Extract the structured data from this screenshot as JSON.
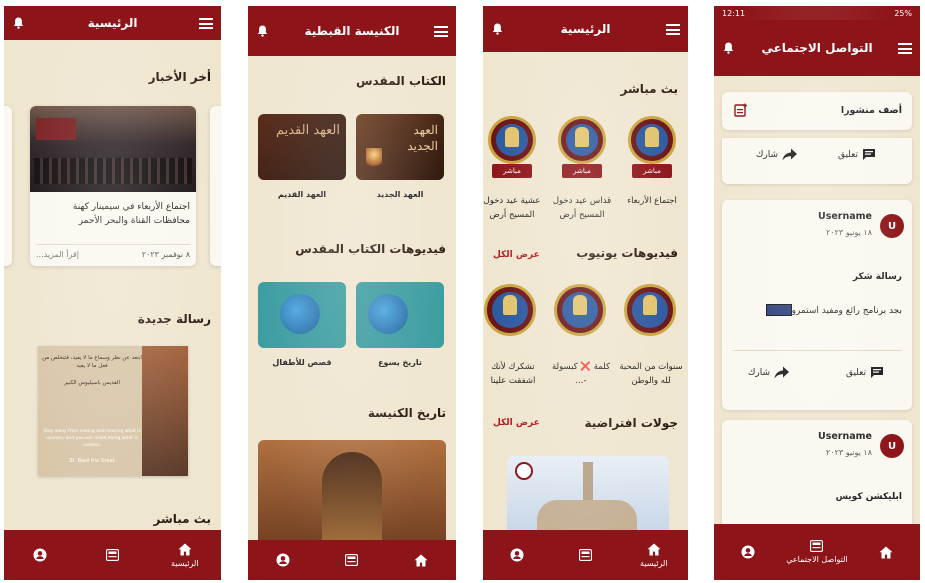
{
  "screen1": {
    "header_title": "الرئيسية",
    "latest_news": "أخر الأخبار",
    "news_text": "اجتماع الأربعاء في سيمينار كهنة محافظات القناة والبحر الأحمر",
    "news_date": "٨ نوفمبر ٢٠٢٣",
    "read_more": "إقرأ المزيد...",
    "new_message": "رسالة جديدة",
    "message_ar": "ابتعد عن نظر وسماع ما لا يفيد، فتتخلص من فعل ما لا يفيد",
    "message_ar_sign": "القديس باسيليوس الكبير",
    "message_en": "Stay away from seeing and hearing what is useless, and you will avoid doing what is useless.",
    "message_en_sign": "St. Basil the Great",
    "live_partial": "بث مباشر",
    "nav_home": "الرئيسية"
  },
  "screen2": {
    "header_title": "الكنيسة القبطية",
    "bible": "الكتاب المقدس",
    "old_testament_img": "العهد القديم",
    "new_testament_img": "العهد الجديد",
    "old_testament": "العهد القديم",
    "new_testament": "العهد الجديد",
    "bible_videos": "فيديوهات الكتاب المقدس",
    "kids_stories": "قصص للأطفال",
    "jesus_history": "تاريخ يسوع",
    "church_history": "تاريخ الكنيسة"
  },
  "screen3": {
    "header_title": "الرئيسية",
    "live": "بث مباشر",
    "live_badge": "مباشر",
    "live_items": [
      "اجتماع الأربعاء",
      "قداس عيد دخول المسيح أرض مصر",
      "عشية عيد دخول المسيح أرض مصر"
    ],
    "view_all": "عرض الكل",
    "youtube": "فيديوهات يوتيوب",
    "yt_items": [
      "سنوات من المحبة لله والوطن",
      "كلمة ❌ كبسولة -...",
      "تشكرك لأنك اشفقت علينا"
    ],
    "virtual_tours": "جولات افتراضية",
    "nav_home": "الرئيسية"
  },
  "screen4": {
    "status_time": "12:11",
    "status_battery": "25%",
    "header_title": "التواصل الاجتماعي",
    "add_post": "أضف منشورا",
    "comment": "تعليق",
    "share": "شارك",
    "posts": [
      {
        "avatar": "U",
        "user": "Username",
        "date": "١٨ يونيو ٢٠٢٣",
        "title": "رسالة شكر",
        "body": "بجد برنامج رائع ومفيد استمروا"
      },
      {
        "avatar": "U",
        "user": "Username",
        "date": "١٨ يونيو ٢٠٢٣",
        "title": "ابليكشن كويس",
        "body": ""
      }
    ],
    "nav_social": "التواصل الاجتماعي"
  },
  "colors": {
    "primary": "#8d1418",
    "background": "#efe6d0",
    "accent_link": "#b01a1f"
  }
}
